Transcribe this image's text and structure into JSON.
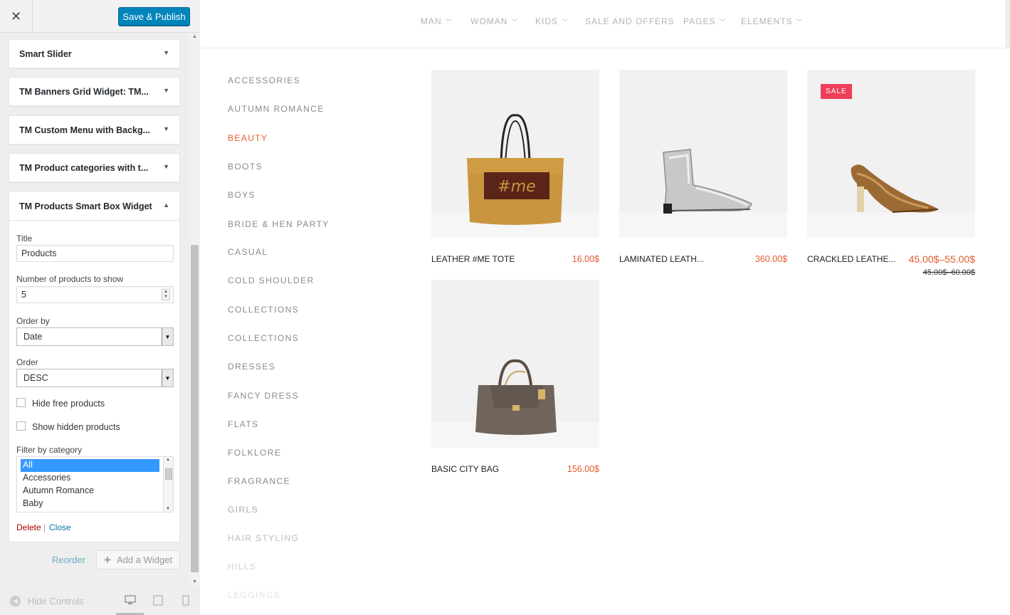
{
  "sidebar": {
    "close_glyph": "✕",
    "save_label": "Save & Publish",
    "widgets": [
      {
        "title": "Smart Slider"
      },
      {
        "title": "TM Banners Grid Widget: TM..."
      },
      {
        "title": "TM Custom Menu with Backg..."
      },
      {
        "title": "TM Product categories with t..."
      }
    ],
    "open_widget": {
      "title": "TM Products Smart Box Widget",
      "title_label": "Title",
      "title_value": "Products",
      "count_label": "Number of products to show",
      "count_value": "5",
      "orderby_label": "Order by",
      "orderby_value": "Date",
      "order_label": "Order",
      "order_value": "DESC",
      "hide_free_label": "Hide free products",
      "hide_free_checked": false,
      "show_hidden_label": "Show hidden products",
      "show_hidden_checked": false,
      "filter_label": "Filter by category",
      "filter_options": [
        "All",
        "Accessories",
        "Autumn Romance",
        "Baby"
      ],
      "filter_selected": "All",
      "delete_label": "Delete",
      "separator": "|",
      "close_label": "Close"
    },
    "reorder_label": "Reorder",
    "add_widget_label": "Add a Widget",
    "hide_controls_label": "Hide Controls"
  },
  "preview": {
    "nav": [
      "MAN",
      "WOMAN",
      "KIDS",
      "SALE AND OFFERS",
      "PAGES",
      "ELEMENTS"
    ],
    "categories": [
      "ACCESSORIES",
      "AUTUMN ROMANCE",
      "BEAUTY",
      "BOOTS",
      "BOYS",
      "BRIDE & HEN PARTY",
      "CASUAL",
      "COLD SHOULDER",
      "COLLECTIONS",
      "COLLECTIONS",
      "DRESSES",
      "FANCY DRESS",
      "FLATS",
      "FOLKLORE",
      "FRAGRANCE",
      "GIRLS",
      "HAIR STYLING",
      "HILLS",
      "LEGGINGS"
    ],
    "active_category": "BEAUTY",
    "products": [
      {
        "name": "LEATHER #ME TOTE",
        "price": "16.00$",
        "image_text": "#me"
      },
      {
        "name": "LAMINATED LEATH...",
        "price": "360.00$"
      },
      {
        "name": "CRACKLED LEATHE...",
        "price": "45.00$–55.00$",
        "old_price": "45.00$–60.00$",
        "badge": "SALE"
      },
      {
        "name": "BASIC CITY BAG",
        "price": "156.00$"
      }
    ]
  },
  "colors": {
    "accent": "#e45b2e",
    "primary_button": "#0085ba",
    "sale_badge": "#ee3e5a",
    "link": "#0073aa",
    "delete": "#a00000"
  }
}
